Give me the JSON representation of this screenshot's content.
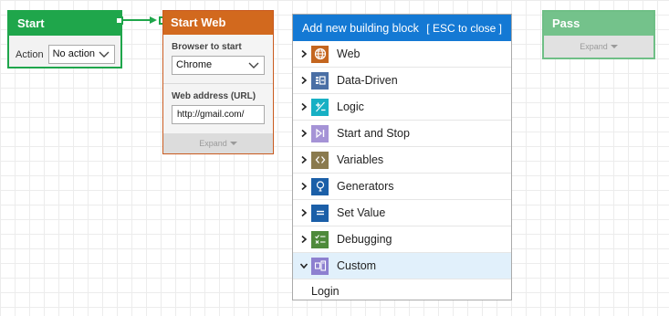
{
  "start_block": {
    "title": "Start",
    "action_label": "Action",
    "action_value": "No action",
    "color": "#1fa64b"
  },
  "web_block": {
    "title": "Start Web Browser",
    "browser_label": "Browser to start",
    "browser_value": "Chrome",
    "url_label": "Web address (URL)",
    "url_value": "http://gmail.com/",
    "expand_label": "Expand",
    "color": "#d2691e"
  },
  "pass_block": {
    "title": "Pass",
    "expand_label": "Expand",
    "color": "#74c28b"
  },
  "popup": {
    "title": "Add new building block",
    "close_hint": "[ ESC to close ]",
    "header_color": "#1479d4",
    "categories": [
      {
        "label": "Web",
        "icon": "globe-icon",
        "color": "#c4661f",
        "expanded": false
      },
      {
        "label": "Data-Driven",
        "icon": "data-driven-icon",
        "color": "#4a6fa5",
        "expanded": false
      },
      {
        "label": "Logic",
        "icon": "plus-minus-icon",
        "color": "#17b0c4",
        "expanded": false
      },
      {
        "label": "Start and Stop",
        "icon": "play-stop-icon",
        "color": "#a593d6",
        "expanded": false
      },
      {
        "label": "Variables",
        "icon": "code-brackets-icon",
        "color": "#8a7a4e",
        "expanded": false
      },
      {
        "label": "Generators",
        "icon": "lightbulb-icon",
        "color": "#1b5fa8",
        "expanded": false
      },
      {
        "label": "Set Value",
        "icon": "equals-icon",
        "color": "#1b5fa8",
        "expanded": false
      },
      {
        "label": "Debugging",
        "icon": "checklist-icon",
        "color": "#4e8a3b",
        "expanded": false
      },
      {
        "label": "Custom",
        "icon": "custom-blocks-icon",
        "color": "#8d80d0",
        "expanded": true
      }
    ],
    "custom_items": [
      "Login"
    ]
  }
}
